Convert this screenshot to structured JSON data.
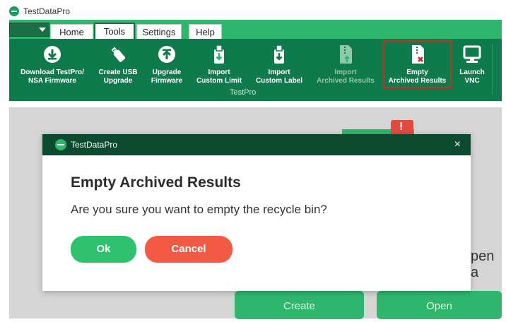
{
  "app": {
    "title": "TestDataPro"
  },
  "ribbon": {
    "tabs": [
      {
        "label": "Home",
        "active": false
      },
      {
        "label": "Tools",
        "active": true
      },
      {
        "label": "Settings",
        "active": false
      },
      {
        "label": "Help",
        "active": false
      }
    ],
    "buttons": [
      {
        "label": "Download TestPro/\nNSA Firmware",
        "icon": "download-icon",
        "enabled": true
      },
      {
        "label": "Create USB\nUpgrade",
        "icon": "usb-drive-icon",
        "enabled": true
      },
      {
        "label": "Upgrade\nFirmware",
        "icon": "upload-icon",
        "enabled": true
      },
      {
        "label": "Import\nCustom Limit",
        "icon": "import-file-icon",
        "enabled": true
      },
      {
        "label": "Import\nCustom Label",
        "icon": "import-file-icon",
        "enabled": true
      },
      {
        "label": "Import\nArchived Results",
        "icon": "import-archive-icon",
        "enabled": false
      },
      {
        "label": "Empty\nArchived Results",
        "icon": "empty-archive-icon",
        "enabled": true,
        "highlighted": true
      },
      {
        "label": "Launch\nVNC",
        "icon": "monitor-icon",
        "enabled": true
      }
    ],
    "group_label": "TestPro"
  },
  "background": {
    "partial_text": "pen a",
    "buttons": [
      "Create",
      "Open"
    ]
  },
  "dialog": {
    "window_title": "TestDataPro",
    "close_glyph": "×",
    "heading": "Empty Archived Results",
    "message": "Are you sure you want to empty the recycle bin?",
    "ok_label": "Ok",
    "cancel_label": "Cancel"
  },
  "colors": {
    "ribbon_dark": "#0f7a4c",
    "ribbon_light": "#2eb66c",
    "ok": "#2ec26e",
    "cancel": "#f25a44",
    "highlight": "#e52020"
  }
}
